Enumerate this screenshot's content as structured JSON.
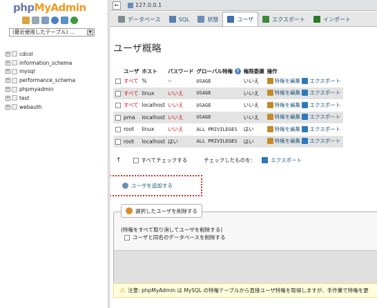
{
  "left": {
    "logo_a": "php",
    "logo_b": "MyAdmin",
    "db_select": "(最近使用したテーブル) ...",
    "databases": [
      "cdcol",
      "information_schema",
      "mysql",
      "performance_schema",
      "phpmyadmin",
      "test",
      "webauth"
    ]
  },
  "topbar": {
    "server": "127.0.0.1"
  },
  "tabs": [
    {
      "label": "データベース",
      "color": "#7f8c8d"
    },
    {
      "label": "SQL",
      "color": "#5b7fb0"
    },
    {
      "label": "状態",
      "color": "#6f8db5"
    },
    {
      "label": "ユーザ",
      "color": "#3d6fae"
    },
    {
      "label": "エクスポート",
      "color": "#3c8a3c"
    },
    {
      "label": "インポート",
      "color": "#2a7b2a"
    }
  ],
  "page_title": "ユーザ概略",
  "table": {
    "headers": [
      "ユーザ",
      "ホスト",
      "パスワード",
      "グローバル特権",
      "権限委譲",
      "操作"
    ],
    "rows": [
      {
        "user": "すべて",
        "user_red": true,
        "host": "%",
        "password": "--",
        "pw_red": false,
        "priv": "USAGE",
        "grant": "いいえ"
      },
      {
        "user": "すべて",
        "user_red": true,
        "host": "linux",
        "password": "いいえ",
        "pw_red": true,
        "priv": "USAGE",
        "grant": "いいえ"
      },
      {
        "user": "すべて",
        "user_red": true,
        "host": "localhost",
        "password": "いいえ",
        "pw_red": true,
        "priv": "USAGE",
        "grant": "いいえ"
      },
      {
        "user": "pma",
        "user_red": false,
        "host": "localhost",
        "password": "いいえ",
        "pw_red": true,
        "priv": "USAGE",
        "grant": "いいえ"
      },
      {
        "user": "root",
        "user_red": false,
        "host": "linux",
        "password": "いいえ",
        "pw_red": true,
        "priv": "ALL PRIVILEGES",
        "grant": "はい"
      },
      {
        "user": "root",
        "user_red": false,
        "host": "localhost",
        "password": "はい",
        "pw_red": false,
        "priv": "ALL PRIVILEGES",
        "grant": "はい"
      }
    ],
    "edit_label": "特権を編集",
    "export_label": "エクスポート"
  },
  "check_all": "すべてチェックする",
  "with_selected": "チェックしたものを:",
  "with_selected_export": "エクスポート",
  "add_user": "ユーザを追加する",
  "delete_legend": "選択したユーザを削除する",
  "delete_note": "(特権をすべて取り消してユーザを削除する)",
  "delete_db_option": "ユーザと同名のデータベースを削除する",
  "notice": "注意: phpMyAdmin は MySQL の特権テーブルから直接ユーザ特権を取得しますが、手作業で特権を更"
}
